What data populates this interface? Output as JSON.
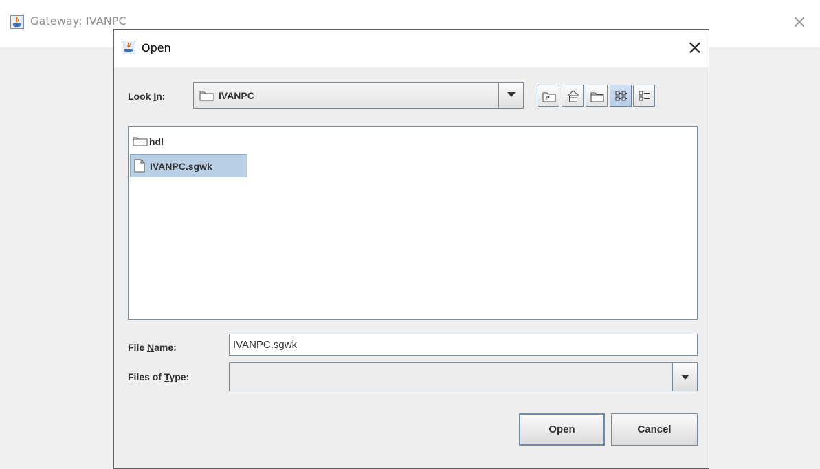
{
  "background_window": {
    "title": "Gateway: IVANPC"
  },
  "dialog": {
    "title": "Open",
    "look_in": {
      "label_prefix": "Look ",
      "label_mnemonic": "I",
      "label_suffix": "n:",
      "value": "IVANPC"
    },
    "toolbar": [
      {
        "name": "up-one-level",
        "icon": "folder-up-icon"
      },
      {
        "name": "home",
        "icon": "home-icon"
      },
      {
        "name": "new-folder",
        "icon": "new-folder-icon"
      },
      {
        "name": "list-view",
        "icon": "list-view-icon",
        "selected": true
      },
      {
        "name": "details-view",
        "icon": "details-view-icon"
      }
    ],
    "files": [
      {
        "name": "hdl",
        "type": "folder",
        "selected": false
      },
      {
        "name": "IVANPC.sgwk",
        "type": "file",
        "selected": true
      }
    ],
    "file_name": {
      "label_prefix": "File ",
      "label_mnemonic": "N",
      "label_suffix": "ame:",
      "value": "IVANPC.sgwk"
    },
    "files_of_type": {
      "label_prefix": "Files of ",
      "label_mnemonic": "T",
      "label_suffix": "ype:",
      "value": ""
    },
    "buttons": {
      "open": "Open",
      "cancel": "Cancel"
    }
  },
  "colors": {
    "selection": "#b8cfe5",
    "border": "#7a8a99",
    "dialog_bg": "#eeeeee"
  }
}
